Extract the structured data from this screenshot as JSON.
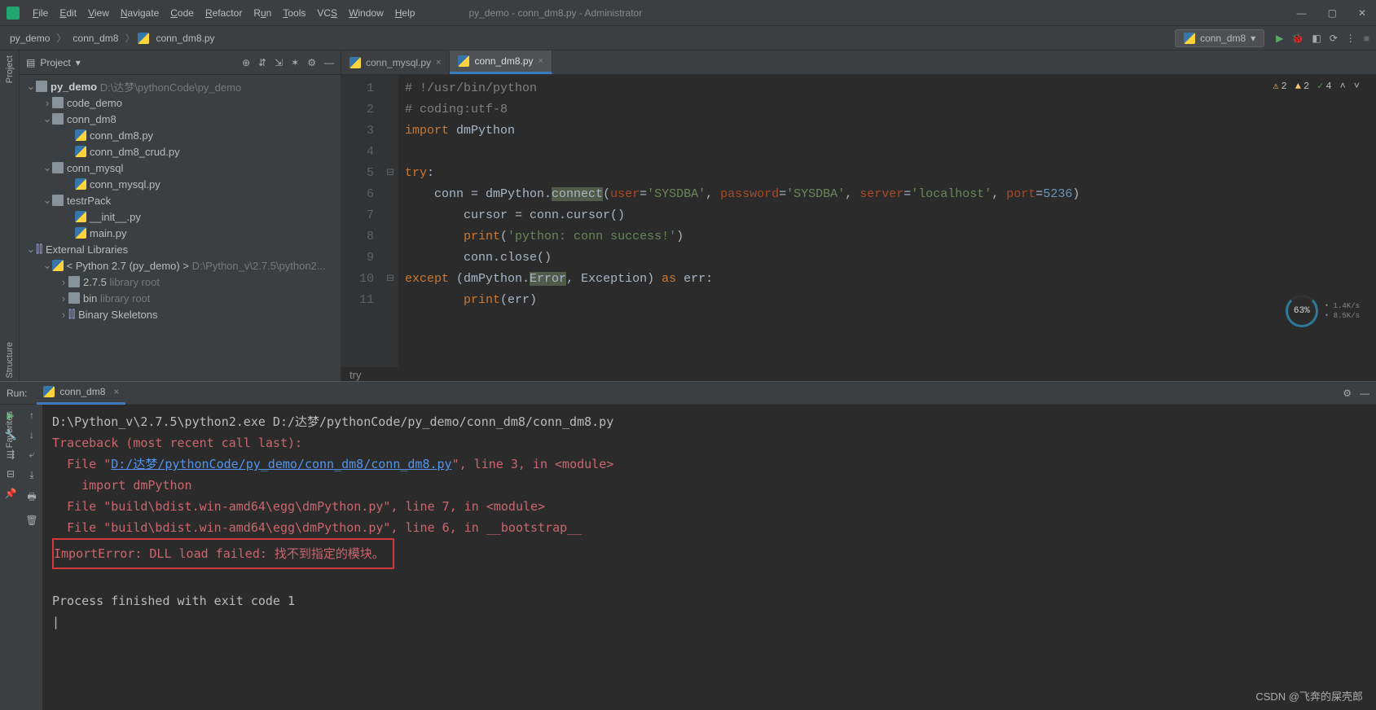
{
  "title": "py_demo - conn_dm8.py - Administrator",
  "menu": [
    "File",
    "Edit",
    "View",
    "Navigate",
    "Code",
    "Refactor",
    "Run",
    "Tools",
    "VCS",
    "Window",
    "Help"
  ],
  "breadcrumb": [
    "py_demo",
    "conn_dm8",
    "conn_dm8.py"
  ],
  "run_config_selected": "conn_dm8",
  "project_panel_title": "Project",
  "tree": {
    "root": {
      "name": "py_demo",
      "path": "D:\\达梦\\pythonCode\\py_demo"
    },
    "items": [
      {
        "indent": 1,
        "arrow": "›",
        "name": "code_demo",
        "type": "folder"
      },
      {
        "indent": 1,
        "arrow": "⌄",
        "name": "conn_dm8",
        "type": "folder"
      },
      {
        "indent": 2,
        "arrow": "",
        "name": "conn_dm8.py",
        "type": "py"
      },
      {
        "indent": 2,
        "arrow": "",
        "name": "conn_dm8_crud.py",
        "type": "py"
      },
      {
        "indent": 1,
        "arrow": "⌄",
        "name": "conn_mysql",
        "type": "folder"
      },
      {
        "indent": 2,
        "arrow": "",
        "name": "conn_mysql.py",
        "type": "py"
      },
      {
        "indent": 1,
        "arrow": "⌄",
        "name": "testrPack",
        "type": "folder"
      },
      {
        "indent": 2,
        "arrow": "",
        "name": "__init__.py",
        "type": "py"
      },
      {
        "indent": 2,
        "arrow": "",
        "name": "main.py",
        "type": "py"
      }
    ],
    "ext_lib": "External Libraries",
    "python": {
      "name": "< Python 2.7 (py_demo) >",
      "path": "D:\\Python_v\\2.7.5\\python2..."
    },
    "ver": "2.7.5",
    "ver_note": "library root",
    "bin": "bin",
    "bin_note": "library root",
    "skel": "Binary Skeletons"
  },
  "tabs": [
    {
      "name": "conn_mysql.py",
      "active": false
    },
    {
      "name": "conn_dm8.py",
      "active": true
    }
  ],
  "code": {
    "l1": "# !/usr/bin/python",
    "l2": "# coding:utf-8",
    "l3_import": "import",
    "l3_mod": "dmPython",
    "l5_try": "try",
    "l5_colon": ":",
    "l6_conn": "conn = dmPython.",
    "l6_connect": "connect",
    "l6_open": "(",
    "l6_user": "user",
    "l6_eq1": "=",
    "l6_s1": "'SYSDBA'",
    "l6_c1": ", ",
    "l6_pwd": "password",
    "l6_eq2": "=",
    "l6_s2": "'SYSDBA'",
    "l6_c2": ", ",
    "l6_srv": "server",
    "l6_eq3": "=",
    "l6_s3": "'localhost'",
    "l6_c3": ", ",
    "l6_port": "port",
    "l6_eq4": "=",
    "l6_n": "5236",
    "l6_close": ")",
    "l7": "        cursor = conn.cursor()",
    "l8_print": "print",
    "l8_open": "(",
    "l8_str": "'python: conn success!'",
    "l8_close": ")",
    "l9": "        conn.close()",
    "l10_except": "except",
    "l10_open": " (dmPython.",
    "l10_err": "Error",
    "l10_mid": ", Exception) ",
    "l10_as": "as",
    "l10_var": " err:",
    "l11_print": "print",
    "l11_rest": "(err)",
    "context": "try"
  },
  "hints": {
    "w1": "2",
    "w2": "2",
    "c1": "4"
  },
  "perf": {
    "val": "63%",
    "s1": "1.4K/s",
    "s2": "8.5K/s"
  },
  "run_label": "Run:",
  "run_tab_name": "conn_dm8",
  "console": {
    "cmd": "D:\\Python_v\\2.7.5\\python2.exe D:/达梦/pythonCode/py_demo/conn_dm8/conn_dm8.py",
    "tb": "Traceback (most recent call last):",
    "f1a": "  File \"",
    "f1link": "D:/达梦/pythonCode/py_demo/conn_dm8/conn_dm8.py",
    "f1b": "\", line 3, in <module>",
    "imp": "    import dmPython",
    "f2": "  File \"build\\bdist.win-amd64\\egg\\dmPython.py\", line 7, in <module>",
    "f3": "  File \"build\\bdist.win-amd64\\egg\\dmPython.py\", line 6, in __bootstrap__",
    "err": "ImportError: DLL load failed: 找不到指定的模块。",
    "exit": "Process finished with exit code 1"
  },
  "side_labels": {
    "project": "Project",
    "structure": "Structure",
    "favorites": "Favorites"
  },
  "watermark": "CSDN @飞奔的屎壳郎"
}
